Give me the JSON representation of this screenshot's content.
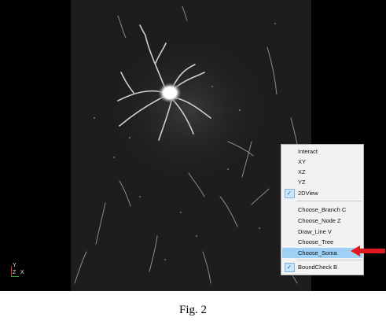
{
  "menu": {
    "items": [
      {
        "label": "Interact",
        "checked": false
      },
      {
        "label": "XY",
        "checked": false
      },
      {
        "label": "XZ",
        "checked": false
      },
      {
        "label": "YZ",
        "checked": false
      },
      {
        "label": "2DView",
        "checked": true
      },
      {
        "label": "Choose_Branch   C",
        "checked": false
      },
      {
        "label": "Choose_Node   Z",
        "checked": false
      },
      {
        "label": "Draw_Line   V",
        "checked": false
      },
      {
        "label": "Choose_Tree",
        "checked": false
      },
      {
        "label": "Choose_Soma",
        "checked": false,
        "highlighted": true
      },
      {
        "label": "BoundCheck   B",
        "checked": true
      }
    ],
    "check_glyph": "✓"
  },
  "axis": {
    "y": "Y",
    "z": "Z",
    "x": "X"
  },
  "caption": "Fig. 2",
  "colors": {
    "highlight": "#9fd0f5",
    "arrow": "#e0191e",
    "menu_bg": "#f2f2f2"
  },
  "icons": {
    "check": "checkmark-icon",
    "pointer": "red-arrow-icon"
  }
}
